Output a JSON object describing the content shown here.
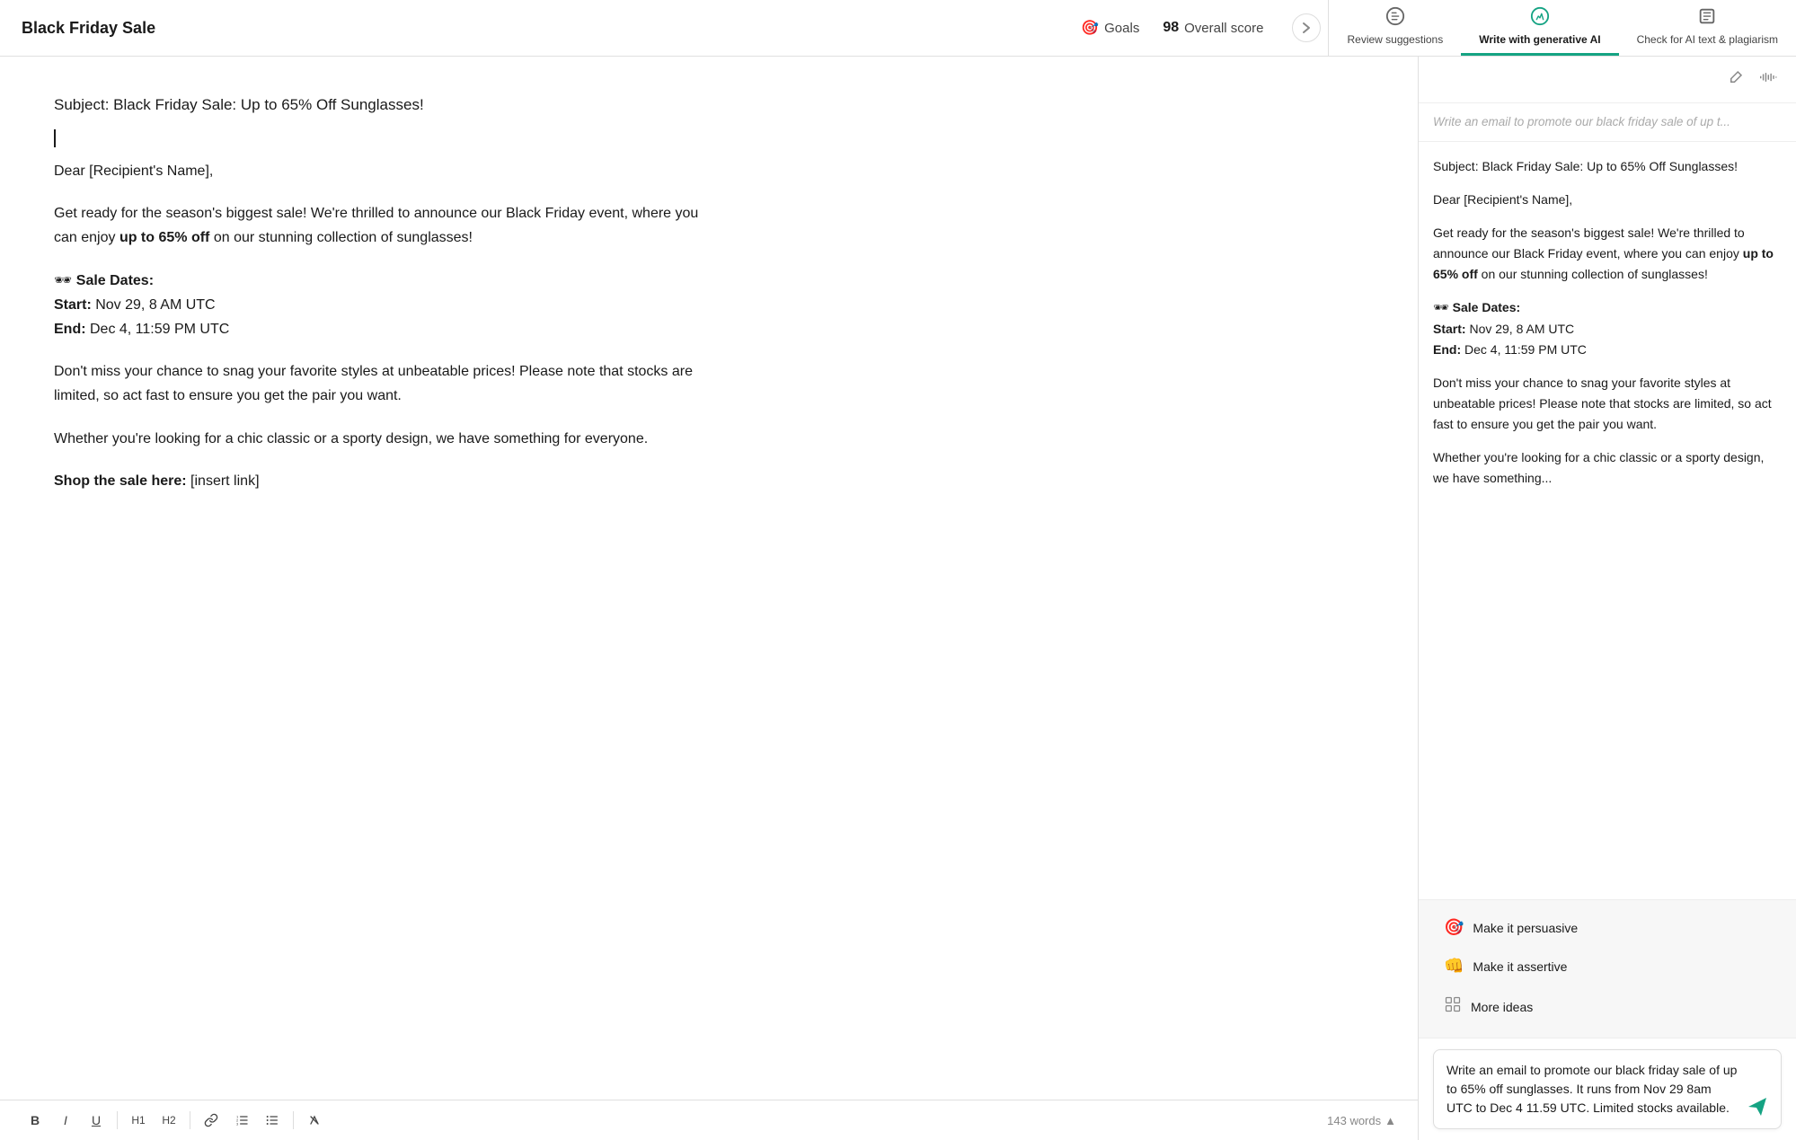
{
  "header": {
    "doc_title": "Black Friday Sale",
    "goals_label": "Goals",
    "score_number": "98",
    "score_label": "Overall score"
  },
  "tabs": [
    {
      "id": "review",
      "label": "Review suggestions",
      "active": false
    },
    {
      "id": "write",
      "label": "Write with generative AI",
      "active": true
    },
    {
      "id": "check",
      "label": "Check for AI text & plagiarism",
      "active": false
    }
  ],
  "editor": {
    "subject_line": "Subject: Black Friday Sale: Up to 65% Off Sunglasses!",
    "paragraph1": "Dear [Recipient's Name],",
    "paragraph2": "Get ready for the season's biggest sale! We're thrilled to announce our Black Friday event, where you can enjoy **up to 65% off** on our stunning collection of sunglasses!",
    "paragraph3_header": "🕶 **Sale Dates:**",
    "paragraph3_start": "**Start:** Nov 29, 8 AM UTC",
    "paragraph3_end": "**End:** Dec 4, 11:59 PM UTC",
    "paragraph4": "Don't miss your chance to snag your favorite styles at unbeatable prices! Please note that stocks are limited, so act fast to ensure you get the pair you want.",
    "paragraph5": "Whether you're looking for a chic classic or a sporty design, we have something for everyone.",
    "paragraph6": "**Shop the sale here:** [insert link]",
    "word_count": "143 words"
  },
  "toolbar": {
    "bold": "B",
    "italic": "I",
    "underline": "U",
    "h1": "H1",
    "h2": "H2",
    "link": "🔗",
    "ordered_list": "≡",
    "unordered_list": "☰",
    "clear_format": "⌫"
  },
  "right_panel": {
    "prompt_placeholder": "Write an email to promote our black friday sale of up t...",
    "ai_content": {
      "subject": "Subject: Black Friday Sale: Up to 65% Off Sunglasses!",
      "greeting": "Dear [Recipient's Name],",
      "body1": "Get ready for the season's biggest sale! We're thrilled to announce our Black Friday event, where you can enjoy **up to 65% off** on our stunning collection of sunglasses!",
      "sale_header": "🕶 **Sale Dates:**",
      "sale_start": "**Start:** Nov 29, 8 AM UTC",
      "sale_end": "**End:** Dec 4, 11:59 PM UTC",
      "body2": "Don't miss your chance to snag your favorite styles at unbeatable prices! Please note that stocks are limited, so act fast to ensure you get the pair you want.",
      "body3": "Whether you're looking for a chic classic or a sporty design, we have something..."
    },
    "suggestions": [
      {
        "icon": "🎯",
        "label": "Make it persuasive"
      },
      {
        "icon": "👊",
        "label": "Make it assertive"
      },
      {
        "icon": "⊞",
        "label": "More ideas"
      }
    ],
    "input_text": "Write an email to promote our black friday sale of up to 65% off sunglasses. It runs from Nov 29 8am UTC to Dec 4 11.59 UTC. Limited stocks available."
  }
}
